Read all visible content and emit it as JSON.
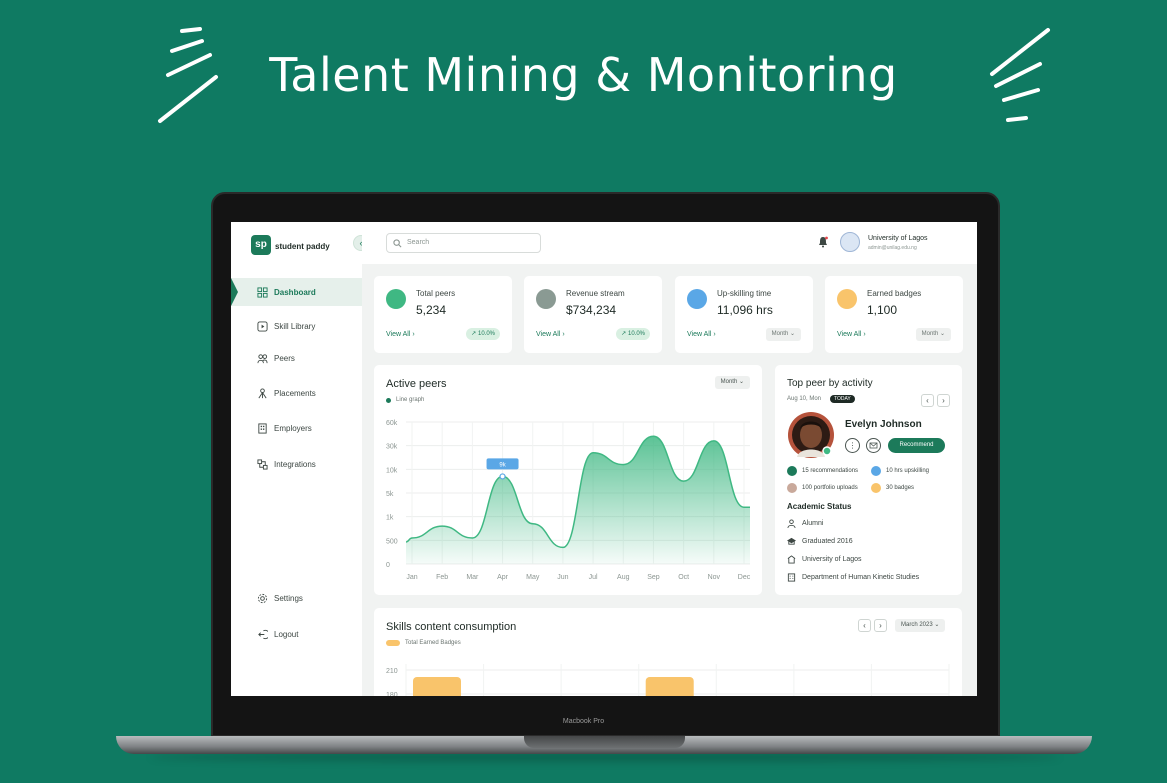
{
  "headline": "Talent Mining & Monitoring",
  "laptop_label": "Macbook Pro",
  "brand": {
    "logo_mark": "sp",
    "name": "student paddy",
    "accent": "#1c7a5a"
  },
  "search": {
    "placeholder": "Search"
  },
  "user": {
    "name": "University of Lagos",
    "email": "admin@unilag.edu.ng"
  },
  "nav": {
    "items": [
      {
        "label": "Dashboard",
        "icon": "grid-icon",
        "active": true
      },
      {
        "label": "Skill Library",
        "icon": "video-icon"
      },
      {
        "label": "Peers",
        "icon": "users-icon"
      },
      {
        "label": "Placements",
        "icon": "network-icon"
      },
      {
        "label": "Employers",
        "icon": "building-icon"
      },
      {
        "label": "Integrations",
        "icon": "integration-icon"
      }
    ],
    "settings": "Settings",
    "logout": "Logout"
  },
  "stats": [
    {
      "label": "Total peers",
      "value": "5,234",
      "link": "View All",
      "badge": "10.0%"
    },
    {
      "label": "Revenue stream",
      "value": "$734,234",
      "link": "View All",
      "badge": "10.0%"
    },
    {
      "label": "Up-skilling time",
      "value": "11,096 hrs",
      "link": "View All",
      "badge": "Month"
    },
    {
      "label": "Earned badges",
      "value": "1,100",
      "link": "View All",
      "badge": "Month"
    }
  ],
  "active_peers": {
    "title": "Active peers",
    "filter": "Month",
    "legend": "Line graph",
    "tooltip": "9k"
  },
  "chart_data": [
    {
      "type": "area",
      "title": "Active peers",
      "legend": [
        "Line graph"
      ],
      "y_ticks": [
        "60k",
        "30k",
        "10k",
        "5k",
        "1k",
        "500",
        "0"
      ],
      "categories": [
        "Jan",
        "Feb",
        "Mar",
        "Apr",
        "May",
        "Jun",
        "Jul",
        "Aug",
        "Sep",
        "Oct",
        "Nov",
        "Dec"
      ],
      "values_tick_units": [
        1.1,
        1.6,
        1.1,
        3.7,
        1.7,
        0.7,
        4.7,
        4.2,
        5.4,
        3.5,
        5.2,
        2.4
      ],
      "highlight": {
        "category": "Apr",
        "label": "9k"
      },
      "color": "#3fb883",
      "grid": true
    },
    {
      "type": "bar",
      "title": "Skills content consumption",
      "legend": [
        "Total Earned Badges"
      ],
      "y_ticks": [
        "210",
        "180"
      ],
      "color": "#f9c46b"
    }
  ],
  "top_peer": {
    "title": "Top peer by activity",
    "date": "Aug 10, Mon",
    "today": "TODAY",
    "name": "Evelyn Johnson",
    "recommend": "Recommend",
    "metrics": [
      {
        "label": "15 recommendations",
        "color": "#1c7a5a"
      },
      {
        "label": "10 hrs upskilling",
        "color": "#5aa7e6"
      },
      {
        "label": "100 portfolio uploads",
        "color": "#c9a99b"
      },
      {
        "label": "30 badges",
        "color": "#f9c46b"
      }
    ],
    "academic_title": "Academic Status",
    "academic": [
      {
        "label": "Alumni",
        "icon": "person-icon"
      },
      {
        "label": "Graduated 2016",
        "icon": "graduation-cap-icon"
      },
      {
        "label": "University of Lagos",
        "icon": "school-icon"
      },
      {
        "label": "Department of Human Kinetic Studies",
        "icon": "building-icon"
      }
    ]
  },
  "skills": {
    "title": "Skills content consumption",
    "legend": "Total Earned Badges",
    "period": "March 2023"
  }
}
